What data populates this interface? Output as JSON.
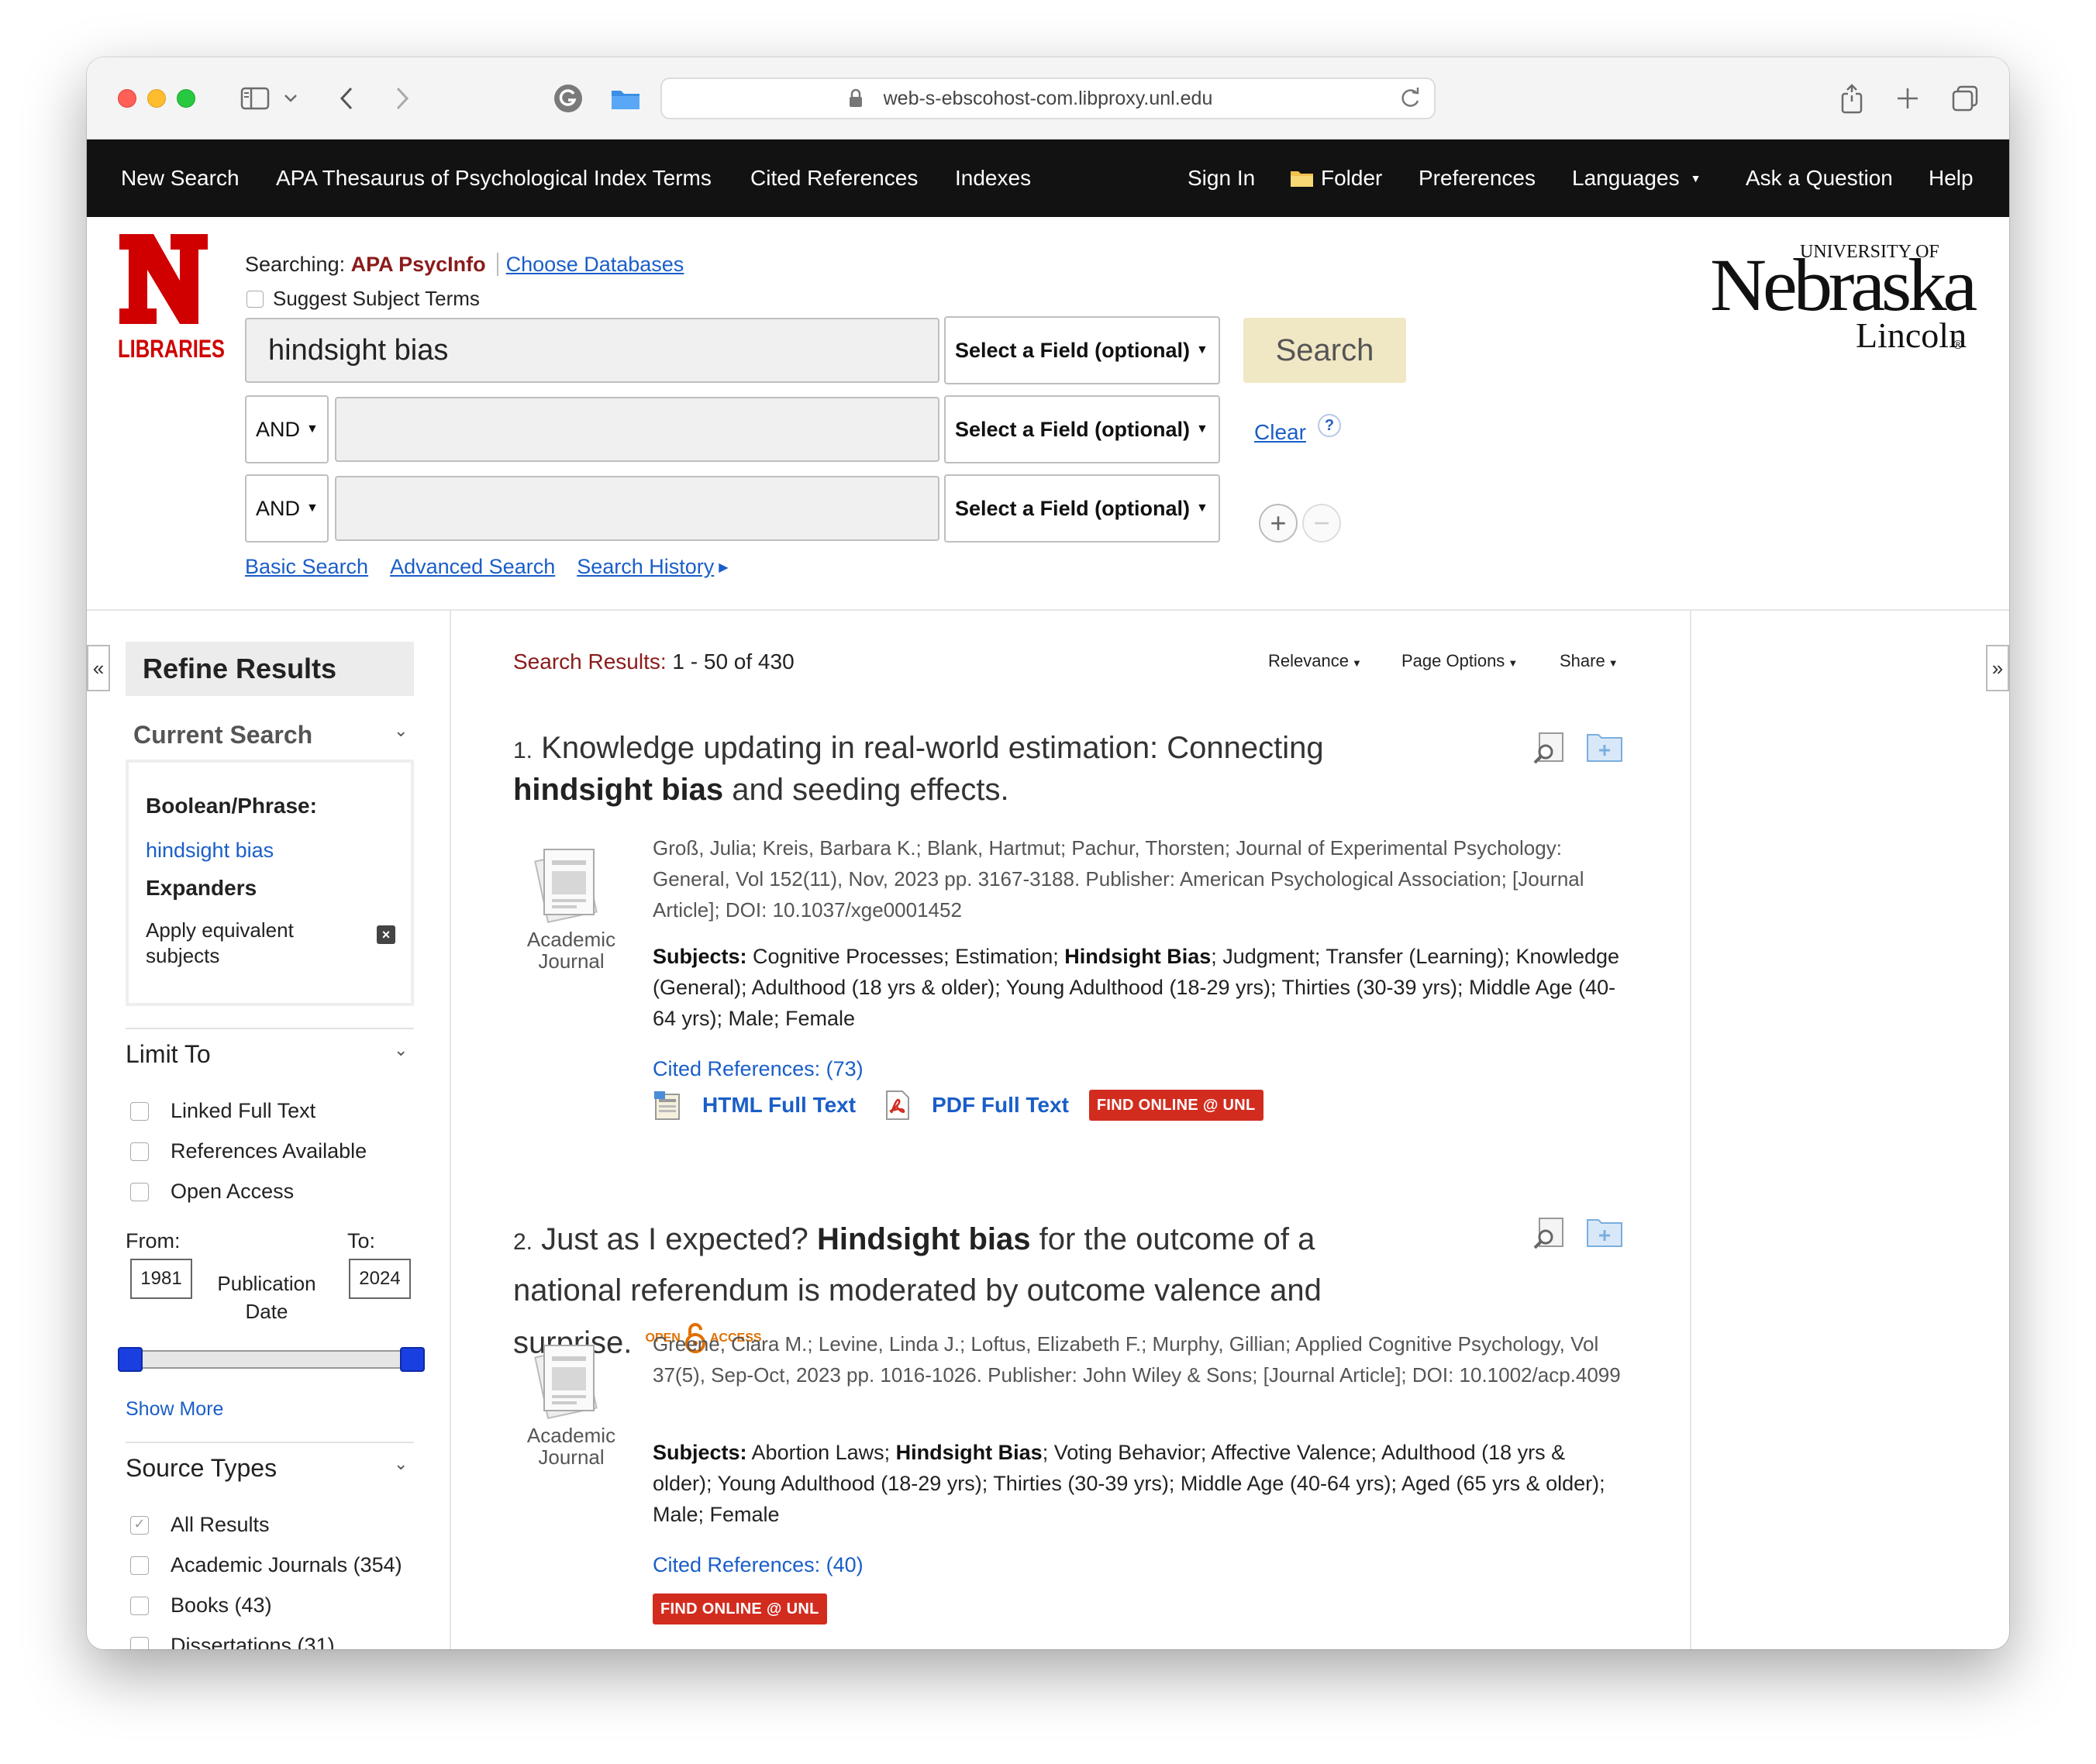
{
  "browser": {
    "url": "web-s-ebscohost-com.libproxy.unl.edu"
  },
  "topnav": {
    "left": [
      "New Search",
      "APA Thesaurus of Psychological Index Terms",
      "Cited References",
      "Indexes"
    ],
    "sign_in": "Sign In",
    "folder": "Folder",
    "preferences": "Preferences",
    "languages": "Languages",
    "ask": "Ask a Question",
    "help": "Help"
  },
  "header": {
    "libraries_label": "LIBRARIES",
    "searching_label": "Searching:",
    "database": "APA PsycInfo",
    "choose_db": "Choose Databases",
    "suggest_label": "Suggest Subject Terms",
    "row1_value": "hindsight bias",
    "field_placeholder": "Select a Field (optional)",
    "bool_op": "AND",
    "search_button": "Search",
    "clear": "Clear",
    "help_q": "?",
    "links": [
      "Basic Search",
      "Advanced Search",
      "Search History"
    ],
    "unl_logo": {
      "top": "UNIVERSITY OF",
      "main": "Nebraska",
      "sub": "Lincoln",
      "mark": "®"
    }
  },
  "sidebar": {
    "refine_title": "Refine Results",
    "current_search": "Current Search",
    "boolean_label": "Boolean/Phrase:",
    "boolean_value": "hindsight bias",
    "expanders_label": "Expanders",
    "expander_item": "Apply equivalent subjects",
    "limit_to": "Limit To",
    "limit_options": [
      "Linked Full Text",
      "References Available",
      "Open Access"
    ],
    "from_label": "From:",
    "to_label": "To:",
    "from_value": "1981",
    "to_value": "2024",
    "pub_date_label": "Publication Date",
    "show_more": "Show More",
    "source_types": "Source Types",
    "source_options": [
      {
        "label": "All Results",
        "checked": true
      },
      {
        "label": "Academic Journals (354)",
        "checked": false
      },
      {
        "label": "Books (43)",
        "checked": false
      },
      {
        "label": "Dissertations (31)",
        "checked": false
      }
    ]
  },
  "results": {
    "count_label": "Search Results:",
    "count_value": "1 - 50 of 430",
    "sort": "Relevance",
    "page_options": "Page Options",
    "share": "Share",
    "items": [
      {
        "num": "1.",
        "title_a": "Knowledge updating in real-world estimation: Connecting",
        "title_bold": "hindsight bias",
        "title_b": "and seeding effects.",
        "doc_type": "Academic Journal",
        "meta": "Groß, Julia; Kreis, Barbara K.; Blank, Hartmut; Pachur, Thorsten; Journal of Experimental Psychology: General, Vol 152(11), Nov, 2023 pp. 3167-3188. Publisher: American Psychological Association; [Journal Article]; DOI: 10.1037/xge0001452",
        "subjects_label": "Subjects:",
        "subjects_a": "Cognitive Processes; Estimation;",
        "subjects_bold": "Hindsight Bias",
        "subjects_b": "; Judgment; Transfer (Learning); Knowledge (General); Adulthood (18 yrs & older); Young Adulthood (18-29 yrs); Thirties (30-39 yrs); Middle Age (40-64 yrs); Male; Female",
        "cited": "Cited References: (73)",
        "html_full_text": "HTML Full Text",
        "pdf_full_text": "PDF Full Text",
        "find_online": "FIND ONLINE @ UNL"
      },
      {
        "num": "2.",
        "title_a": "Just as I expected?",
        "title_bold": "Hindsight bias",
        "title_b": "for the outcome of a national referendum is moderated by outcome valence and surprise.",
        "oa_open": "OPEN",
        "oa_access": "ACCESS",
        "doc_type": "Academic Journal",
        "meta": "Greene, Ciara M.; Levine, Linda J.; Loftus, Elizabeth F.; Murphy, Gillian; Applied Cognitive Psychology, Vol 37(5), Sep-Oct, 2023 pp. 1016-1026. Publisher: John Wiley & Sons; [Journal Article]; DOI: 10.1002/acp.4099",
        "subjects_label": "Subjects:",
        "subjects_a": "Abortion Laws;",
        "subjects_bold": "Hindsight Bias",
        "subjects_b": "; Voting Behavior; Affective Valence; Adulthood (18 yrs & older); Young Adulthood (18-29 yrs); Thirties (30-39 yrs); Middle Age (40-64 yrs); Aged (65 yrs & older); Male; Female",
        "cited": "Cited References: (40)",
        "find_online": "FIND ONLINE @ UNL"
      }
    ]
  },
  "colors": {
    "nav_bg": "#121212",
    "brand_red": "#d00000",
    "link_blue": "#1a5ec8",
    "search_btn_bg": "#f0e7c4",
    "find_btn": "#d22c1f",
    "slider_handle": "#1a3fe0"
  }
}
